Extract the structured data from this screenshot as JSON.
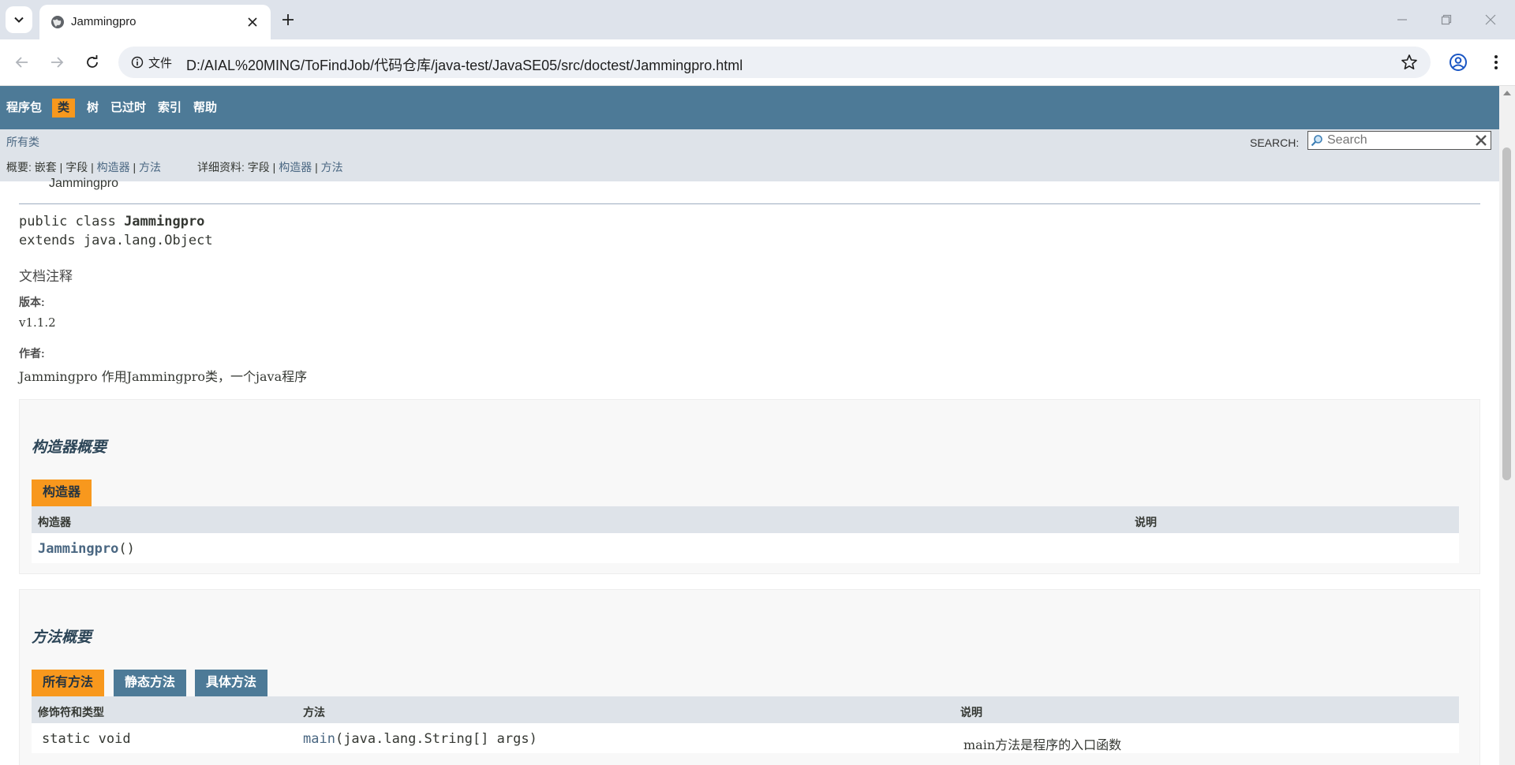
{
  "browser": {
    "tab_title": "Jammingpro",
    "site_info_label": "文件",
    "url": "D:/AIAL%20MING/ToFindJob/代码仓库/java-test/JavaSE05/src/doctest/Jammingpro.html"
  },
  "topnav": {
    "items": [
      {
        "label": "程序包",
        "active": false
      },
      {
        "label": "类",
        "active": true
      },
      {
        "label": "树",
        "active": false
      },
      {
        "label": "已过时",
        "active": false
      },
      {
        "label": "索引",
        "active": false
      },
      {
        "label": "帮助",
        "active": false
      }
    ]
  },
  "subnav": {
    "all_classes": "所有类",
    "search_label": "SEARCH:",
    "search_placeholder": "Search",
    "summary_prefix": "概要: 嵌套 | 字段 |",
    "summary_links": [
      "构造器",
      "方法"
    ],
    "detail_prefix": "详细资料: 字段 |",
    "detail_links": [
      "构造器",
      "方法"
    ],
    "sep": "|"
  },
  "class_info": {
    "class_name_partial": "Jammingpro",
    "signature_line1_prefix": "public class ",
    "signature_class": "Jammingpro",
    "signature_line2": "extends java.lang.Object",
    "description": "文档注释",
    "version_label": "版本:",
    "version_value": "v1.1.2",
    "author_label": "作者:",
    "author_value": "Jammingpro 作用Jammingpro类，一个java程序"
  },
  "constructor_summary": {
    "heading": "构造器概要",
    "caption": "构造器",
    "columns": [
      "构造器",
      "说明"
    ],
    "rows": [
      {
        "name": "Jammingpro",
        "params": "()",
        "description": ""
      }
    ]
  },
  "method_summary": {
    "heading": "方法概要",
    "tabs": [
      {
        "label": "所有方法",
        "active": true
      },
      {
        "label": "静态方法",
        "active": false
      },
      {
        "label": "具体方法",
        "active": false
      }
    ],
    "columns": [
      "修饰符和类型",
      "方法",
      "说明"
    ],
    "rows": [
      {
        "modifier": "static void",
        "name": "main",
        "params": "(java.lang.String[] args)",
        "description": "main方法是程序的入口函数"
      }
    ]
  },
  "colors": {
    "nav_bg": "#4d7a97",
    "active_tab": "#f8981d",
    "subnav_bg": "#dee3e9",
    "link": "#4a6782"
  }
}
